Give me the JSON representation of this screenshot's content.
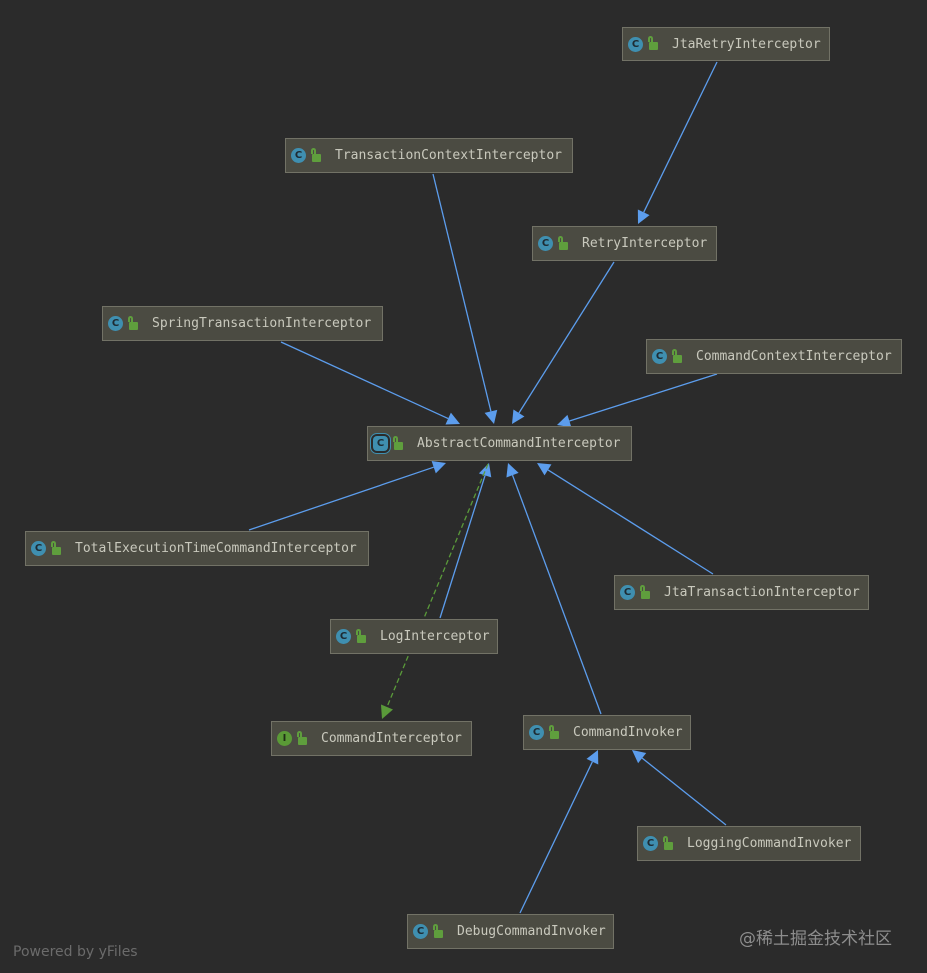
{
  "colors": {
    "background": "#2b2b2b",
    "inheritance_edge": "#5c9ded",
    "implements_edge": "#5a9a3a",
    "class_badge": "#3f8fb0",
    "interface_badge": "#5a9a36"
  },
  "nodes": [
    {
      "id": "jtaRetry",
      "name": "JtaRetryInterceptor",
      "kind": "class",
      "icon": "class-icon"
    },
    {
      "id": "txContext",
      "name": "TransactionContextInterceptor",
      "kind": "class",
      "icon": "class-icon"
    },
    {
      "id": "retry",
      "name": "RetryInterceptor",
      "kind": "class",
      "icon": "class-icon"
    },
    {
      "id": "springTx",
      "name": "SpringTransactionInterceptor",
      "kind": "class",
      "icon": "class-icon"
    },
    {
      "id": "cmdContext",
      "name": "CommandContextInterceptor",
      "kind": "class",
      "icon": "class-icon"
    },
    {
      "id": "abstract",
      "name": "AbstractCommandInterceptor",
      "kind": "abstract",
      "icon": "abstract-class-icon"
    },
    {
      "id": "totalExec",
      "name": "TotalExecutionTimeCommandInterceptor",
      "kind": "class",
      "icon": "class-icon"
    },
    {
      "id": "jtaTx",
      "name": "JtaTransactionInterceptor",
      "kind": "class",
      "icon": "class-icon"
    },
    {
      "id": "log",
      "name": "LogInterceptor",
      "kind": "class",
      "icon": "class-icon"
    },
    {
      "id": "cmdInterceptor",
      "name": "CommandInterceptor",
      "kind": "interface",
      "icon": "interface-icon"
    },
    {
      "id": "invoker",
      "name": "CommandInvoker",
      "kind": "class",
      "icon": "class-icon"
    },
    {
      "id": "loggingInvoker",
      "name": "LoggingCommandInvoker",
      "kind": "class",
      "icon": "class-icon"
    },
    {
      "id": "debugInvoker",
      "name": "DebugCommandInvoker",
      "kind": "class",
      "icon": "class-icon"
    }
  ],
  "badge_letters": {
    "class": "C",
    "abstract": "C",
    "interface": "I"
  },
  "edges": [
    {
      "from": "jtaRetry",
      "to": "retry",
      "type": "extends"
    },
    {
      "from": "txContext",
      "to": "abstract",
      "type": "extends"
    },
    {
      "from": "retry",
      "to": "abstract",
      "type": "extends"
    },
    {
      "from": "springTx",
      "to": "abstract",
      "type": "extends"
    },
    {
      "from": "cmdContext",
      "to": "abstract",
      "type": "extends"
    },
    {
      "from": "totalExec",
      "to": "abstract",
      "type": "extends"
    },
    {
      "from": "jtaTx",
      "to": "abstract",
      "type": "extends"
    },
    {
      "from": "log",
      "to": "abstract",
      "type": "extends"
    },
    {
      "from": "abstract",
      "to": "cmdInterceptor",
      "type": "implements"
    },
    {
      "from": "invoker",
      "to": "abstract",
      "type": "extends"
    },
    {
      "from": "loggingInvoker",
      "to": "invoker",
      "type": "extends"
    },
    {
      "from": "debugInvoker",
      "to": "invoker",
      "type": "extends"
    }
  ],
  "footer": "Powered by yFiles",
  "watermark": "@稀土掘金技术社区"
}
